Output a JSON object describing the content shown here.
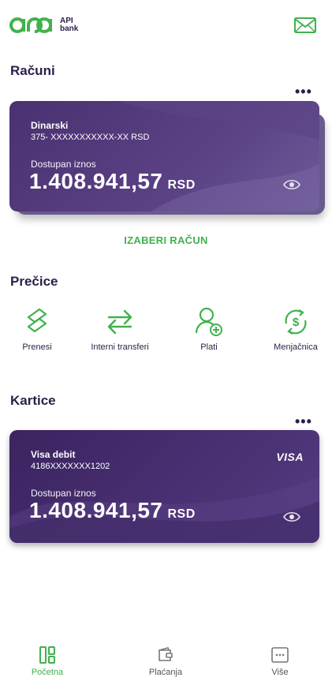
{
  "header": {
    "logo_line1": "API",
    "logo_line2": "bank",
    "mail_icon": "mail-icon"
  },
  "accounts": {
    "title": "Računi",
    "more": "•••",
    "card": {
      "name": "Dinarski",
      "number": "375- XXXXXXXXXXX-XX RSD",
      "available_label": "Dostupan iznos",
      "amount": "1.408.941,57",
      "currency": "RSD"
    },
    "choose_label": "IZABERI RAČUN"
  },
  "shortcuts": {
    "title": "Prečice",
    "items": [
      {
        "label": "Prenesi",
        "icon": "transfer-icon"
      },
      {
        "label": "Interni transferi",
        "icon": "arrows-exchange-icon"
      },
      {
        "label": "Plati",
        "icon": "user-add-icon"
      },
      {
        "label": "Menjačnica",
        "icon": "currency-exchange-icon"
      }
    ]
  },
  "cards": {
    "title": "Kartice",
    "more": "•••",
    "card": {
      "name": "Visa debit",
      "number": "4186XXXXXXX1202",
      "brand": "VISA",
      "available_label": "Dostupan iznos",
      "amount": "1.408.941,57",
      "currency": "RSD"
    }
  },
  "bottom_nav": {
    "items": [
      {
        "label": "Početna",
        "active": true,
        "icon": "home-grid-icon"
      },
      {
        "label": "Plaćanja",
        "active": false,
        "icon": "wallet-icon"
      },
      {
        "label": "Više",
        "active": false,
        "icon": "more-icon"
      }
    ]
  },
  "colors": {
    "accent_green": "#3fb24c",
    "card_purple": "#4a3170",
    "text_dark": "#2c1f4a"
  }
}
